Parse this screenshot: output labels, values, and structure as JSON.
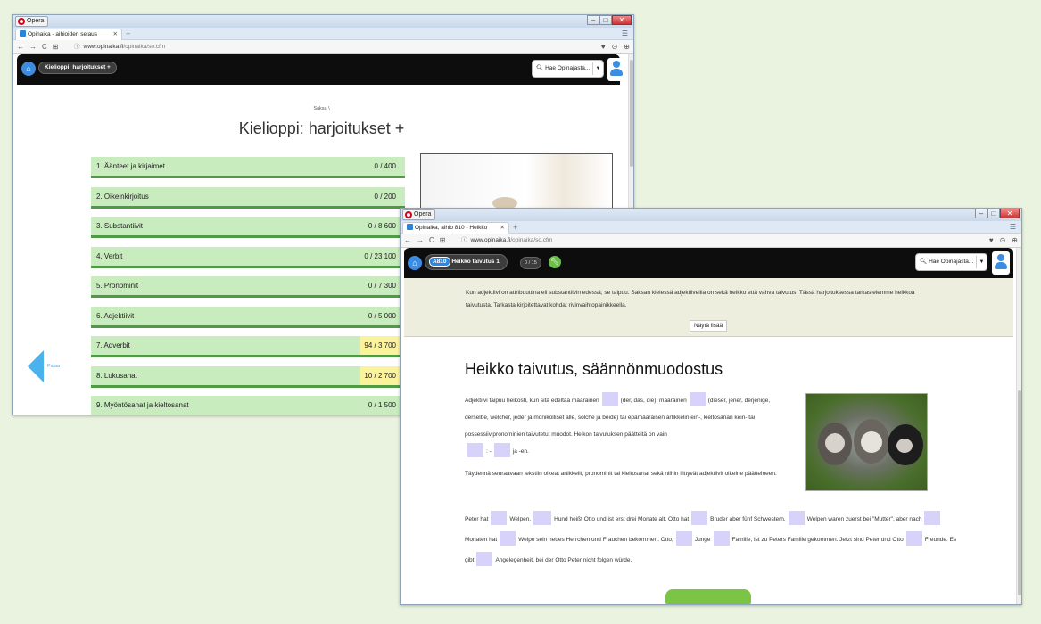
{
  "window1": {
    "opera_label": "Opera",
    "tab_title": "Opinaika - aihioiden selaus",
    "url_domain": "www.opinaika.fi",
    "url_path": "/opinaika/so.cfm",
    "header_pill": "Kielioppi: harjoitukset +",
    "search_label": "Hae Opinajasta...",
    "breadcrumb": "Saksa \\",
    "page_title": "Kielioppi: harjoitukset +",
    "categories": [
      {
        "label": "1. Äänteet ja kirjaimet",
        "score": "0 / 400",
        "highlight": false
      },
      {
        "label": "2. Oikeinkirjoitus",
        "score": "0 / 200",
        "highlight": false
      },
      {
        "label": "3. Substantiivit",
        "score": "0 / 8 600",
        "highlight": false
      },
      {
        "label": "4. Verbit",
        "score": "0 / 23 100",
        "highlight": false
      },
      {
        "label": "5. Pronominit",
        "score": "0 / 7 300",
        "highlight": false
      },
      {
        "label": "6. Adjektiivit",
        "score": "0 / 5 000",
        "highlight": false
      },
      {
        "label": "7. Adverbit",
        "score": "94 / 3 700",
        "highlight": true
      },
      {
        "label": "8. Lukusanat",
        "score": "10 / 2 700",
        "highlight": true
      },
      {
        "label": "9. Myöntösanat ja kieltosanat",
        "score": "0 / 1 500",
        "highlight": false
      }
    ],
    "back_label": "Palaa"
  },
  "window2": {
    "opera_label": "Opera",
    "tab_title": "Opinaika, aihio 810 - Heikko",
    "url_domain": "www.opinaika.fi",
    "url_path": "/opinaika/so.cfm",
    "exercise_id": "A810",
    "exercise_title": "Heikko taivutus 1",
    "counter": "0 / 15",
    "search_label": "Hae Opinajasta...",
    "intro_text": "Kun adjektiivi on attribuuttina eli substantiivin edessä, se taipuu. Saksan kielessä adjektiiveilla on sekä heikko että vahva taivutus. Tässä harjoituksessa tarkastelemme heikkoa taivutusta. Tarkasta kirjoitettavat kohdat rivinvaihtopainikkeella.",
    "show_more": "Näytä lisää",
    "heading": "Heikko taivutus, säännönmuodostus",
    "para1": {
      "t1": "Adjektiivi taipuu heikosti, kun sitä edeltää määräinen",
      "t2": "(der, das, die), määräinen",
      "t3": "(dieser, jener, derjenige, derselbe, welcher, jeder ja monikolliset alle, solche ja beide) tai epämääräisen artikkelin ein-, kieltosanan kein- tai possessiivipronominien taivutetut muodot. Heikon taivutuksen päätteitä on vain",
      "t4": ": -",
      "t5": "ja -en."
    },
    "para2": "Täydennä seuraavaan tekstiin oikeat artikkelit, pronominit tai kieltosanat sekä niihin liittyvät adjektiivit oikeine päätteineen.",
    "story": {
      "s1": "Peter hat",
      "s2": "Welpen.",
      "s3": "Hund heißt Otto und ist erst drei Monate alt. Otto hat",
      "s4": "Bruder aber fünf Schwestern.",
      "s5": "Welpen waren zuerst bei \"Mutter\", aber nach",
      "s6": "Monaten hat",
      "s7": "Welpe sein neues Herrchen und Frauchen bekommen. Otto,",
      "s8": "Junge",
      "s9": "Familie, ist zu Peters Familie gekommen. Jetzt sind Peter und Otto",
      "s10": "Freunde. Es gibt",
      "s11": "Angelegenheit, bei der Otto Peter nicht folgen würde."
    }
  }
}
